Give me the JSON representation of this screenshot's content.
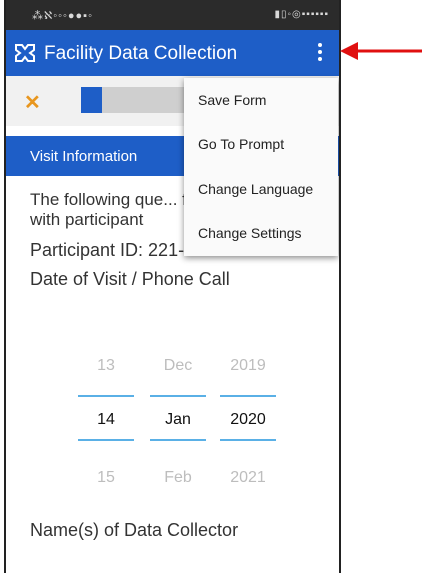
{
  "app": {
    "title": "Facility Data Collection"
  },
  "statusbar": {
    "left": "⁂ℵ◦◦◦●●▪◦",
    "right": "▮▯◦◎▪▪▪▪▪▪"
  },
  "toolbar": {
    "close_icon": "close-icon",
    "progress_fraction": 0.09
  },
  "menu": {
    "items": [
      {
        "label": "Save Form"
      },
      {
        "label": "Go To Prompt"
      },
      {
        "label": "Change Language"
      },
      {
        "label": "Change Settings"
      }
    ]
  },
  "section": {
    "label": "Visit Information"
  },
  "content": {
    "intro": "The following que... filled out before c... with participant",
    "participant_id": "Participant ID: 221-1",
    "date_label": "Date of Visit / Phone Call",
    "collector_label": "Name(s) of Data Collector"
  },
  "date_picker": {
    "day": {
      "prev": "13",
      "current": "14",
      "next": "15"
    },
    "month": {
      "prev": "Dec",
      "current": "Jan",
      "next": "Feb"
    },
    "year": {
      "prev": "2019",
      "current": "2020",
      "next": "2021"
    }
  },
  "colors": {
    "primary": "#1e5ec7",
    "accent": "#e8961e",
    "arrow": "#e01010",
    "picker_line": "#5ab0e6"
  }
}
